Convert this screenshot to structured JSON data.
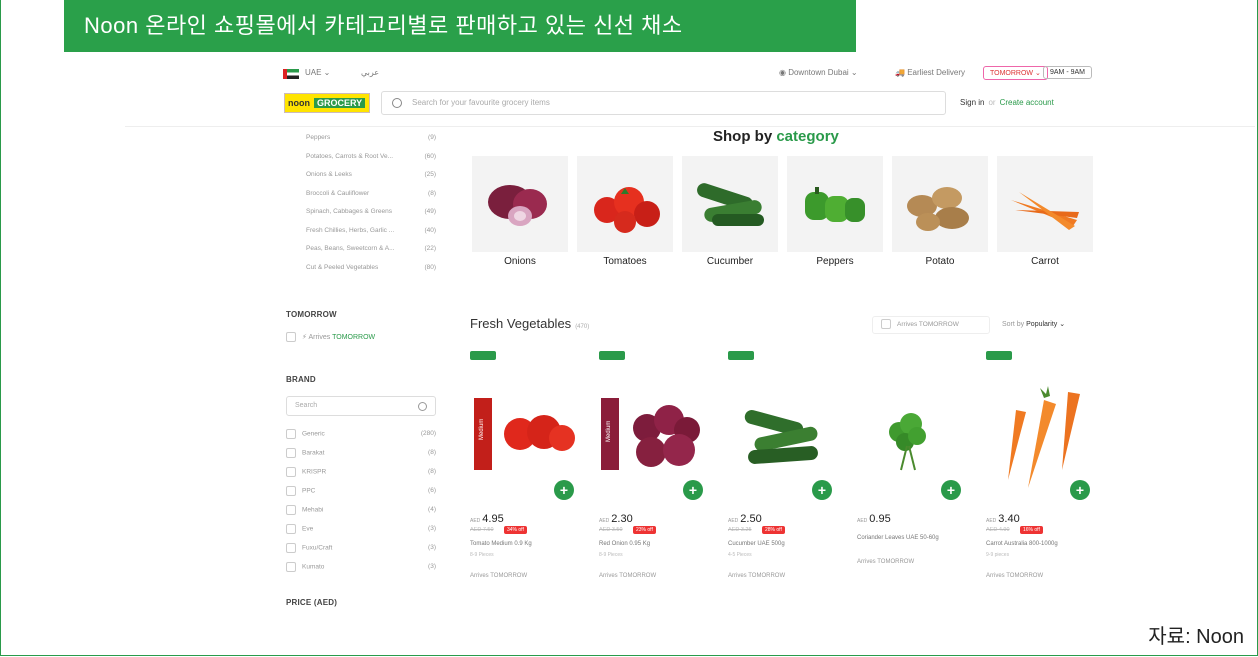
{
  "banner": "Noon 온라인 쇼핑몰에서 카테고리별로 판매하고 있는 신선 채소",
  "source": "자료: Noon",
  "topbar": {
    "country": "UAE ⌄",
    "language": "عربي",
    "location": "◉ Downtown Dubai ⌄",
    "delivery": "Earliest Delivery",
    "tomorrow": "TOMORROW ⌄",
    "time_slot": "9AM - 9AM"
  },
  "header": {
    "logo_main": "noon",
    "logo_sub": "GROCERY",
    "search_placeholder": "Search for your favourite grocery items",
    "sign_in": "Sign in",
    "or": "or",
    "create_account": "Create account"
  },
  "sidebar": {
    "subcategories": [
      {
        "label": "Peppers",
        "count": "(9)"
      },
      {
        "label": "Potatoes, Carrots & Root Ve...",
        "count": "(60)"
      },
      {
        "label": "Onions & Leeks",
        "count": "(25)"
      },
      {
        "label": "Broccoli & Cauliflower",
        "count": "(8)"
      },
      {
        "label": "Spinach, Cabbages & Greens",
        "count": "(49)"
      },
      {
        "label": "Fresh Chillies, Herbs, Garlic ...",
        "count": "(40)"
      },
      {
        "label": "Peas, Beans, Sweetcorn & A...",
        "count": "(22)"
      },
      {
        "label": "Cut & Peeled Vegetables",
        "count": "(80)"
      }
    ],
    "tomorrow_title": "TOMORROW",
    "arrives_prefix": "Arrives",
    "arrives_when": "TOMORROW",
    "brand_title": "BRAND",
    "brand_search_placeholder": "Search",
    "brands": [
      {
        "label": "Generic",
        "count": "(280)"
      },
      {
        "label": "Barakat",
        "count": "(8)"
      },
      {
        "label": "KRISPR",
        "count": "(8)"
      },
      {
        "label": "PPC",
        "count": "(6)"
      },
      {
        "label": "Mehabi",
        "count": "(4)"
      },
      {
        "label": "Eve",
        "count": "(3)"
      },
      {
        "label": "Fuxu/Craft",
        "count": "(3)"
      },
      {
        "label": "Kumato",
        "count": "(3)"
      }
    ],
    "price_title": "PRICE (AED)"
  },
  "shop": {
    "title_prefix": "Shop by",
    "title_highlight": "category",
    "categories": [
      "Onions",
      "Tomatoes",
      "Cucumber",
      "Peppers",
      "Potato",
      "Carrot"
    ]
  },
  "listing": {
    "title": "Fresh Vegetables",
    "count": "(470)",
    "filter_arrives": "Arrives TOMORROW",
    "sort_label": "Sort by",
    "sort_value": "Popularity ⌄"
  },
  "products": [
    {
      "currency": "AED",
      "price": "4.95",
      "old": "AED 7.50",
      "off": "34% off",
      "name": "Tomato Medium 0.9 Kg",
      "count": "8-9 Pieces",
      "arrives": "Arrives TOMORROW",
      "ribbon": "Medium"
    },
    {
      "currency": "AED",
      "price": "2.30",
      "old": "AED 3.50",
      "off": "23% off",
      "name": "Red Onion 0.95 Kg",
      "count": "8-9 Pieces",
      "arrives": "Arrives TOMORROW",
      "ribbon": "Medium"
    },
    {
      "currency": "AED",
      "price": "2.50",
      "old": "AED 3.25",
      "off": "28% off",
      "name": "Cucumber UAE 500g",
      "count": "4-5 Pieces",
      "arrives": "Arrives TOMORROW",
      "ribbon": ""
    },
    {
      "currency": "AED",
      "price": "0.95",
      "old": "",
      "off": "",
      "name": "Coriander Leaves UAE 50-60g",
      "count": "",
      "arrives": "Arrives TOMORROW",
      "ribbon": ""
    },
    {
      "currency": "AED",
      "price": "3.40",
      "old": "AED 4.90",
      "off": "16% off",
      "name": "Carrot Australia 800-1000g",
      "count": "9-9 pieces",
      "arrives": "Arrives TOMORROW",
      "ribbon": ""
    }
  ]
}
